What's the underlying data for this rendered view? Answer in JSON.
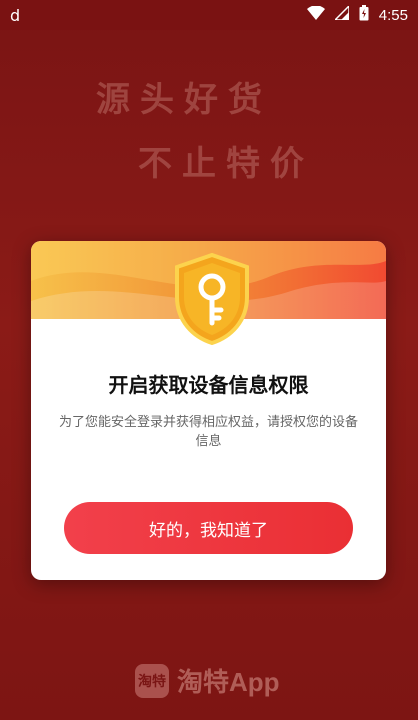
{
  "status_bar": {
    "left_icon": "d-notification-icon",
    "time": "4:55",
    "battery_icon": "battery-icon",
    "signal_icon": "signal-icon",
    "wifi_icon": "wifi-icon"
  },
  "background": {
    "slogan_line1": "源头好货",
    "slogan_line2": "不止特价"
  },
  "dialog": {
    "icon": "shield-key-icon",
    "title": "开启获取设备信息权限",
    "description": "为了您能安全登录并获得相应权益，请授权您的设备信息",
    "button_label": "好的，我知道了"
  },
  "brand": {
    "logo_text": "淘特",
    "name": "淘特App"
  },
  "colors": {
    "background": "#7d1513",
    "button": "#ea2f34",
    "header_gradient_start": "#f7c14a",
    "header_gradient_end": "#f14a31"
  }
}
